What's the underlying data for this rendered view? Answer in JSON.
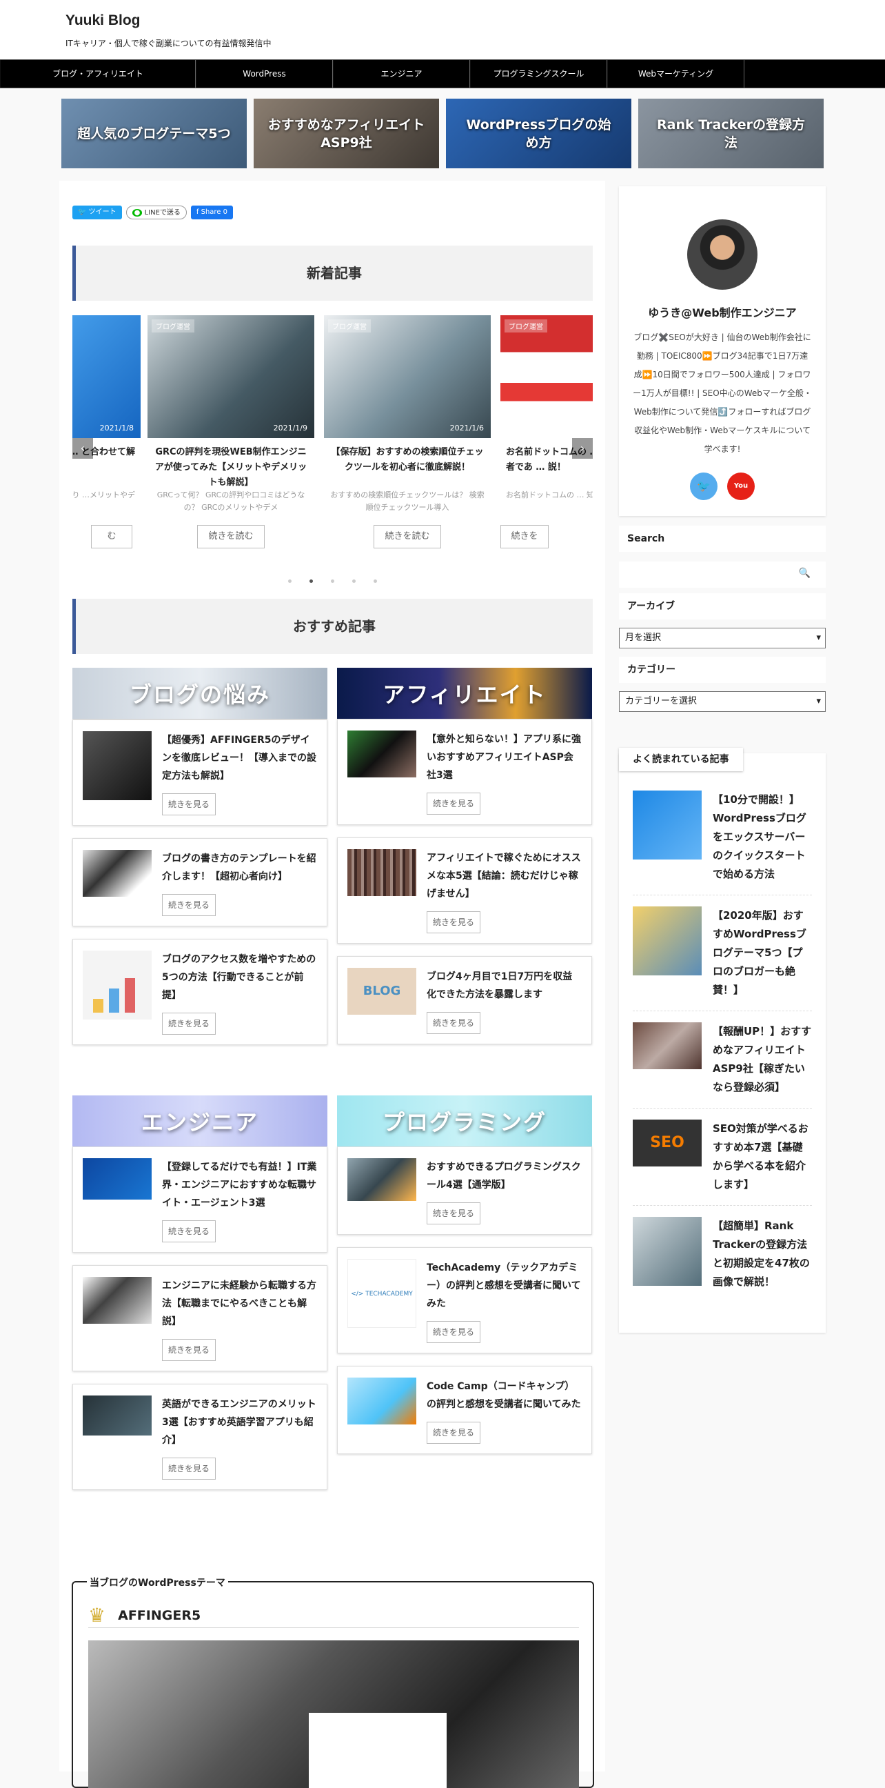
{
  "site": {
    "title": "Yuuki Blog",
    "description": "ITキャリア・個人で稼ぐ副業についての有益情報発信中"
  },
  "nav": [
    "ブログ・アフィリエイト",
    "WordPress",
    "エンジニア",
    "プログラミングスクール",
    "Webマーケティング"
  ],
  "pickup": [
    {
      "label": "超人気のブログテーマ5つ",
      "color": "#4a6a8a"
    },
    {
      "label": "おすすめなアフィリエイトASP9社",
      "color": "#5b5550"
    },
    {
      "label": "WordPressブログの始め方",
      "color": "#1e4d8c"
    },
    {
      "label": "Rank Trackerの登録方法",
      "color": "#6d7883"
    }
  ],
  "share": {
    "tweet": "ツイート",
    "line": "LINEで送る",
    "fb": "Share 0"
  },
  "new_posts": {
    "heading": "新着記事",
    "slides": [
      {
        "title": "GRCの口コミをデ … と合わせて解",
        "excerpt": "…の口コミを知り …メリットやデ",
        "date": "2021/1/8",
        "category": "",
        "more": "む"
      },
      {
        "title": "GRCの評判を現役WEB制作エンジニアが使ってみた【メリットやデメリットも解説】",
        "excerpt": "GRCって何？ GRCの評判や口コミはどうなの？ GRCのメリットやデメ",
        "date": "2021/1/9",
        "category": "ブログ運営",
        "more": "続きを読む"
      },
      {
        "title": "【保存版】おすすめの検索順位チェックツールを初心者に徹底解説！",
        "excerpt": "おすすめの検索順位チェックツールは？ 検索順位チェックツール導入",
        "date": "2021/1/6",
        "category": "ブログ運営",
        "more": "続きを読む"
      },
      {
        "title": "お名前ドットコムの … を実際の利用者であ … 説！",
        "excerpt": "お名前ドットコムの … 知りたい！ お名前ド",
        "date": "",
        "category": "ブログ運営",
        "more": "続きを"
      }
    ],
    "dots": 5,
    "active_dot": 1
  },
  "recommended": {
    "heading": "おすすめ記事",
    "more_label": "続きを見る",
    "left_top": {
      "banner": "ブログの悩み",
      "items": [
        "【超優秀】AFFINGER5のデザインを徹底レビュー！【導入までの設定方法も解説】",
        "ブログの書き方のテンプレートを紹介します！【超初心者向け】",
        "ブログのアクセス数を増やすための5つの方法【行動できることが前提】"
      ]
    },
    "right_top": {
      "banner": "アフィリエイト",
      "items": [
        "【意外と知らない！】アプリ系に強いおすすめアフィリエイトASP会社3選",
        "アフィリエイトで稼ぐためにオススメな本5選【結論：読むだけじゃ稼げません】",
        "ブログ4ヶ月目で1日7万円を収益化できた方法を暴露します"
      ]
    },
    "left_bottom": {
      "banner": "エンジニア",
      "items": [
        "【登録してるだけでも有益！】IT業界・エンジニアにおすすめな転職サイト・エージェント3選",
        "エンジニアに未経験から転職する方法【転職までにやるべきことも解説】",
        "英語ができるエンジニアのメリット3選【おすすめ英語学習アプリも紹介】"
      ]
    },
    "right_bottom": {
      "banner": "プログラミング",
      "items": [
        "おすすめできるプログラミングスクール4選【通学版】",
        "TechAcademy（テックアカデミー）の評判と感想を受講者に聞いてみた",
        "Code Camp（コードキャンプ）の評判と感想を受講者に聞いてみた"
      ]
    }
  },
  "theme_box": {
    "label": "当ブログのWordPressテーマ",
    "name": "AFFINGER5"
  },
  "profile": {
    "name": "ゆうき@Web制作エンジニア",
    "bio": "ブログ✖️SEOが大好き | 仙台のWeb制作会社に勤務 | TOEIC800⏩ブログ34記事で1日7万達成⏩10日間でフォロワー500人達成 | フォロワー1万人が目標!! | SEO中心のWebマーケ全般・Web制作について発信⤴️フォローすればブログ収益化やWeb制作・Webマーケスキルについて学べます!"
  },
  "widgets": {
    "search_label": "Search",
    "archive_label": "アーカイブ",
    "archive_select": "月を選択",
    "category_label": "カテゴリー",
    "category_select": "カテゴリーを選択",
    "popular_label": "よく読まれている記事"
  },
  "popular": [
    "【10分で開設！】WordPressブログをエックスサーバーのクイックスタートで始める方法",
    "【2020年版】おすすめWordPressブログテーマ5つ【プロのブロガーも絶賛！】",
    "【報酬UP！】おすすめなアフィリエイトASP9社【稼ぎたいなら登録必須】",
    "SEO対策が学べるおすすめ本7選【基礎から学べる本を紹介します】",
    "【超簡単】Rank Trackerの登録方法と初期設定を47枚の画像で解説！"
  ]
}
